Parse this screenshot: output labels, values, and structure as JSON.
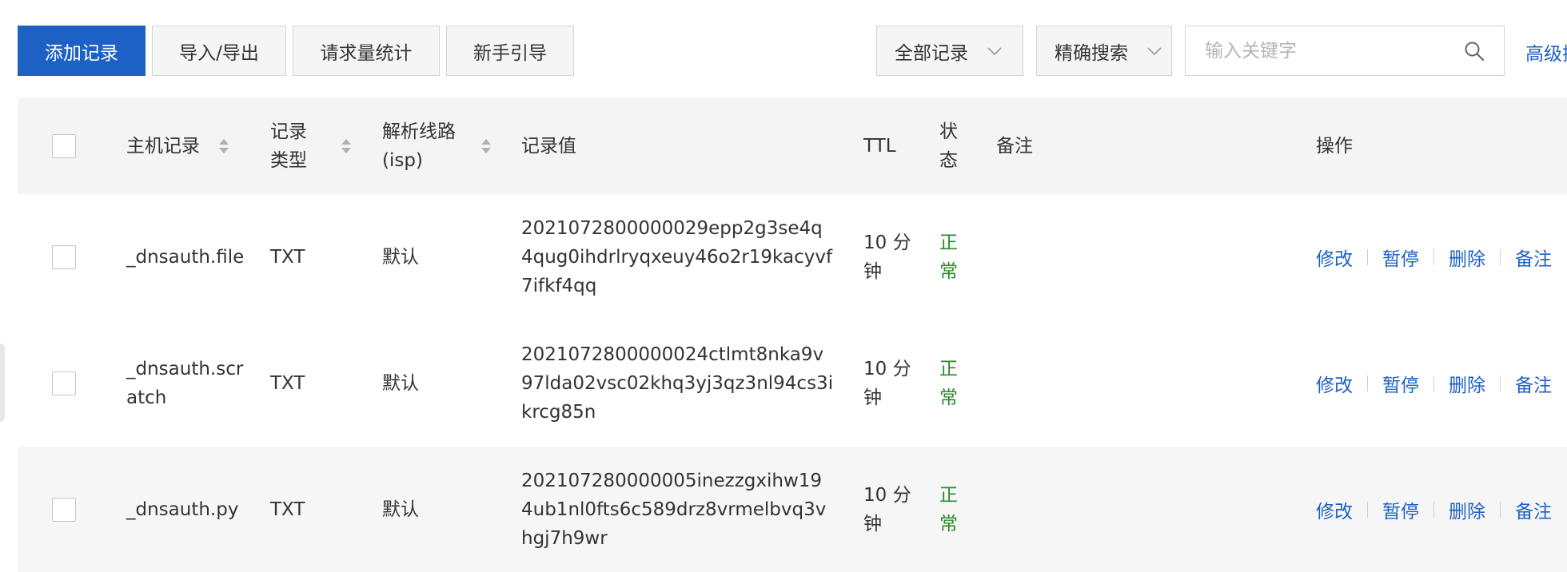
{
  "toolbar": {
    "add_record": "添加记录",
    "import_export": "导入/导出",
    "request_stats": "请求量统计",
    "guide": "新手引导",
    "record_filter": "全部记录",
    "search_mode": "精确搜索",
    "search_placeholder": "输入关键字",
    "advanced": "高级搜索"
  },
  "table": {
    "headers": {
      "host": "主机记录",
      "type_line1": "记录",
      "type_line2": "类型",
      "line_line1": "解析线路",
      "line_line2": "(isp)",
      "value": "记录值",
      "ttl": "TTL",
      "status_line1": "状",
      "status_line2": "态",
      "remark": "备注",
      "ops": "操作"
    },
    "rows": [
      {
        "host_line1": "_dnsauth.file",
        "host_line2": "",
        "type": "TXT",
        "line": "默认",
        "value_line1": "2021072800000029epp2g3se4q",
        "value_line2": "4qug0ihdrlryqxeuy46o2r19kacyvf",
        "value_line3": "7ifkf4qq",
        "ttl_line1": "10 分",
        "ttl_line2": "钟",
        "status_line1": "正",
        "status_line2": "常",
        "remark": ""
      },
      {
        "host_line1": "_dnsauth.scr",
        "host_line2": "atch",
        "type": "TXT",
        "line": "默认",
        "value_line1": "2021072800000024ctlmt8nka9v",
        "value_line2": "97lda02vsc02khq3yj3qz3nl94cs3i",
        "value_line3": "krcg85n",
        "ttl_line1": "10 分",
        "ttl_line2": "钟",
        "status_line1": "正",
        "status_line2": "常",
        "remark": ""
      },
      {
        "host_line1": "_dnsauth.py",
        "host_line2": "",
        "type": "TXT",
        "line": "默认",
        "value_line1": "202107280000005inezzgxihw19",
        "value_line2": "4ub1nl0fts6c589drz8vrmelbvq3v",
        "value_line3": "hgj7h9wr",
        "ttl_line1": "10 分",
        "ttl_line2": "钟",
        "status_line1": "正",
        "status_line2": "常",
        "remark": ""
      }
    ],
    "ops": {
      "edit": "修改",
      "pause": "暂停",
      "delete": "删除",
      "remark": "备注"
    }
  },
  "colors": {
    "primary": "#1d61c4",
    "status_ok": "#2a8a2a",
    "header_bg": "#f4f4f4",
    "highlight_row_bg": "#f6f6f6"
  },
  "icons": {
    "search": "search-icon",
    "chevron": "chevron-down-icon",
    "sort": "sort-icon"
  }
}
